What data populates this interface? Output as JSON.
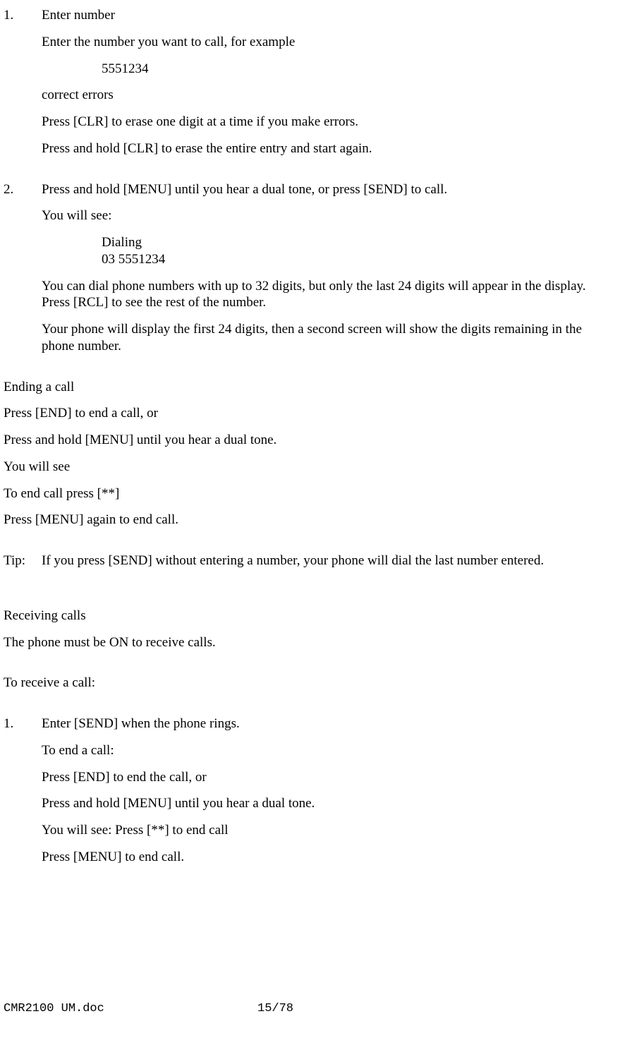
{
  "step1": {
    "marker": "1.",
    "title": "Enter number",
    "line1": "Enter the number you want to call, for example",
    "example": "5551234",
    "line2": "correct errors",
    "line3": "Press [CLR] to erase one digit at a time if you make errors.",
    "line4": "Press and hold [CLR] to erase the entire entry and start again."
  },
  "step2": {
    "marker": "2.",
    "title": "Press and hold [MENU] until you hear a dual tone, or press [SEND] to call.",
    "line1": "You will see:",
    "display1": "Dialing",
    "display2": "03 5551234",
    "line2": "You can dial phone numbers with up to 32 digits, but only the last 24 digits will appear in the display. Press [RCL] to see the rest of the number.",
    "line3": "Your phone will display the first 24 digits, then a second screen will show the digits remaining in the phone number."
  },
  "ending": {
    "heading": "Ending a call",
    "line1": "Press [END] to end a call, or",
    "line2": "Press and hold [MENU] until you hear a dual tone.",
    "line3": "You will see",
    "line4": "To end call press [**]",
    "line5": "Press [MENU] again to end call."
  },
  "tip": {
    "label": "Tip:",
    "text": "If you press [SEND] without entering a number, your phone will dial the last number entered."
  },
  "receiving": {
    "heading": "Receiving calls",
    "line1": "The phone must be ON to receive calls.",
    "line2": "To receive a call:"
  },
  "receive_step1": {
    "marker": "1.",
    "title": "Enter [SEND] when the phone rings.",
    "line1": "To end a call:",
    "line2": "Press [END] to end the call, or",
    "line3": "Press and hold [MENU] until you hear a dual tone.",
    "line4": "You will see:  Press [**] to end call",
    "line5": "Press [MENU] to end call."
  },
  "footer": {
    "filename": "CMR2100 UM.doc",
    "page": "15/78"
  }
}
